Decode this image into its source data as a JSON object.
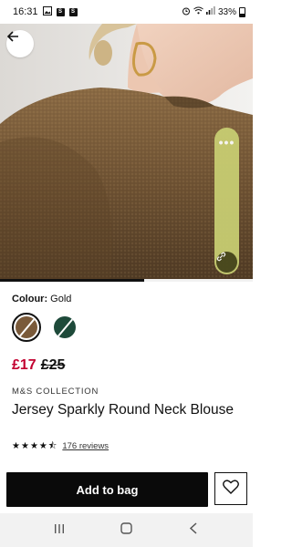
{
  "status_bar": {
    "time": "16:31",
    "battery": "33%",
    "notification_icons": [
      "gallery-icon",
      "s-icon",
      "s-icon"
    ],
    "indicator_icons": [
      "alarm-icon",
      "wifi-icon",
      "signal-icon",
      "battery-icon"
    ]
  },
  "hero": {
    "progress_fraction": 0.57,
    "pill_dots": "•••",
    "pill_color": "#c9cf73"
  },
  "product": {
    "colour_label": "Colour:",
    "colour_value": "Gold",
    "swatches": [
      {
        "name": "gold",
        "color": "#7a5a3a",
        "selected": true
      },
      {
        "name": "green",
        "color": "#1e4a3a",
        "selected": false
      }
    ],
    "price_now": "£17",
    "price_was": "£25",
    "brand": "M&S COLLECTION",
    "title": "Jersey Sparkly Round Neck Blouse",
    "rating": 4.5,
    "reviews": "176 reviews"
  },
  "actions": {
    "add_to_bag": "Add to bag"
  },
  "colors": {
    "price_red": "#c2002f",
    "button_black": "#0a0a0a"
  }
}
